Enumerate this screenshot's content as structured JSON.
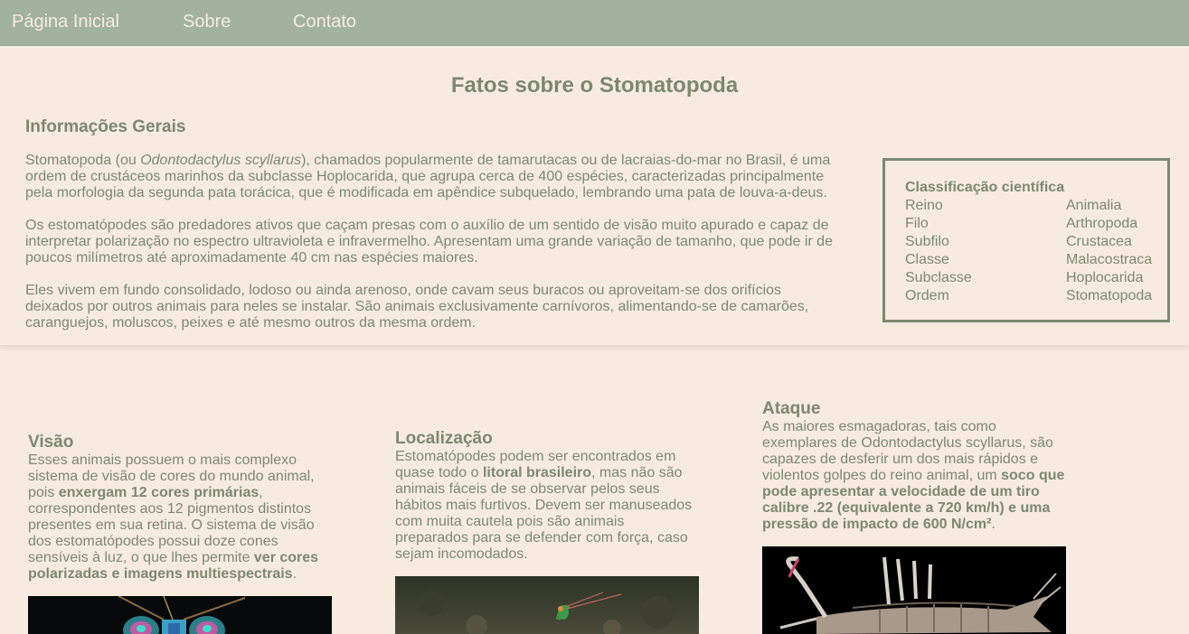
{
  "nav": {
    "items": [
      {
        "label": "Página Inicial"
      },
      {
        "label": "Sobre"
      },
      {
        "label": "Contato"
      }
    ]
  },
  "main": {
    "title": "Fatos sobre o Stomatopoda",
    "subtitle": "Informações Gerais",
    "p1": {
      "pre": "Stomatopoda (ou ",
      "italic": "Odontodactylus scyllarus",
      "post": "), chamados popularmente de tamarutacas ou de lacraias-do-mar no Brasil, é uma ordem de crustáceos marinhos da subclasse Hoplocarida, que agrupa cerca de 400 espécies, caracterizadas principalmente pela morfologia da segunda pata torácica, que é modificada em apêndice subquelado, lembrando uma pata de louva-a-deus."
    },
    "p2": "Os estomatópodes são predadores ativos que caçam presas com o auxílio de um sentido de visão muito apurado e capaz de interpretar polarização no espectro ultravioleta e infravermelho. Apresentam uma grande variação de tamanho, que pode ir de poucos milímetros até aproximadamente 40 cm nas espécies maiores.",
    "p3": "Eles vivem em fundo consolidado, lodoso ou ainda arenoso, onde cavam seus buracos ou aproveitam-se dos orifícios deixados por outros animais para neles se instalar. São animais exclusivamente carnívoros, alimentando-se de camarões, caranguejos, moluscos, peixes e até mesmo outros da mesma ordem."
  },
  "classification": {
    "title": "Classificação científica",
    "rows": [
      {
        "key": "Reino",
        "value": "Animalia"
      },
      {
        "key": "Filo",
        "value": "Arthropoda"
      },
      {
        "key": "Subfilo",
        "value": "Crustacea"
      },
      {
        "key": "Classe",
        "value": "Malacostraca"
      },
      {
        "key": "Subclasse",
        "value": "Hoplocarida"
      },
      {
        "key": "Ordem",
        "value": "Stomatopoda"
      }
    ]
  },
  "cards": {
    "visao": {
      "title": "Visão",
      "t1": "Esses animais possuem o mais complexo sistema de visão de cores do mundo animal, pois ",
      "b1": "enxergam 12 cores primárias",
      "t2": ", correspondentes aos 12 pigmentos distintos presentes em sua retina. O sistema de visão dos estomatópodes possui doze cones sensíveis à luz, o que lhes permite ",
      "b2": "ver cores polarizadas e imagens multiespectrais",
      "t3": "."
    },
    "localizacao": {
      "title": "Localização",
      "t1": "Estomatópodes podem ser encontrados em quase todo o ",
      "b1": "litoral brasileiro",
      "t2": ", mas não são animais fáceis de se observar pelos seus hábitos mais furtivos. Devem ser manuseados com muita cautela pois são animais preparados para se defender com força, caso sejam incomodados."
    },
    "ataque": {
      "title": "Ataque",
      "t1": "As maiores esmagadoras, tais como exemplares de Odontodactylus scyllarus, são capazes de desferir um dos mais rápidos e violentos golpes do reino animal, um ",
      "b1": "soco que pode apresentar a velocidade de um tiro calibre .22 (equivalente a 720 km/h) e uma pressão de impacto de 600 N/cm²",
      "t2": "."
    }
  },
  "colors": {
    "nav_bg": "#a2b29f",
    "page_bg": "#f7ebe0",
    "text": "#7c8870"
  }
}
